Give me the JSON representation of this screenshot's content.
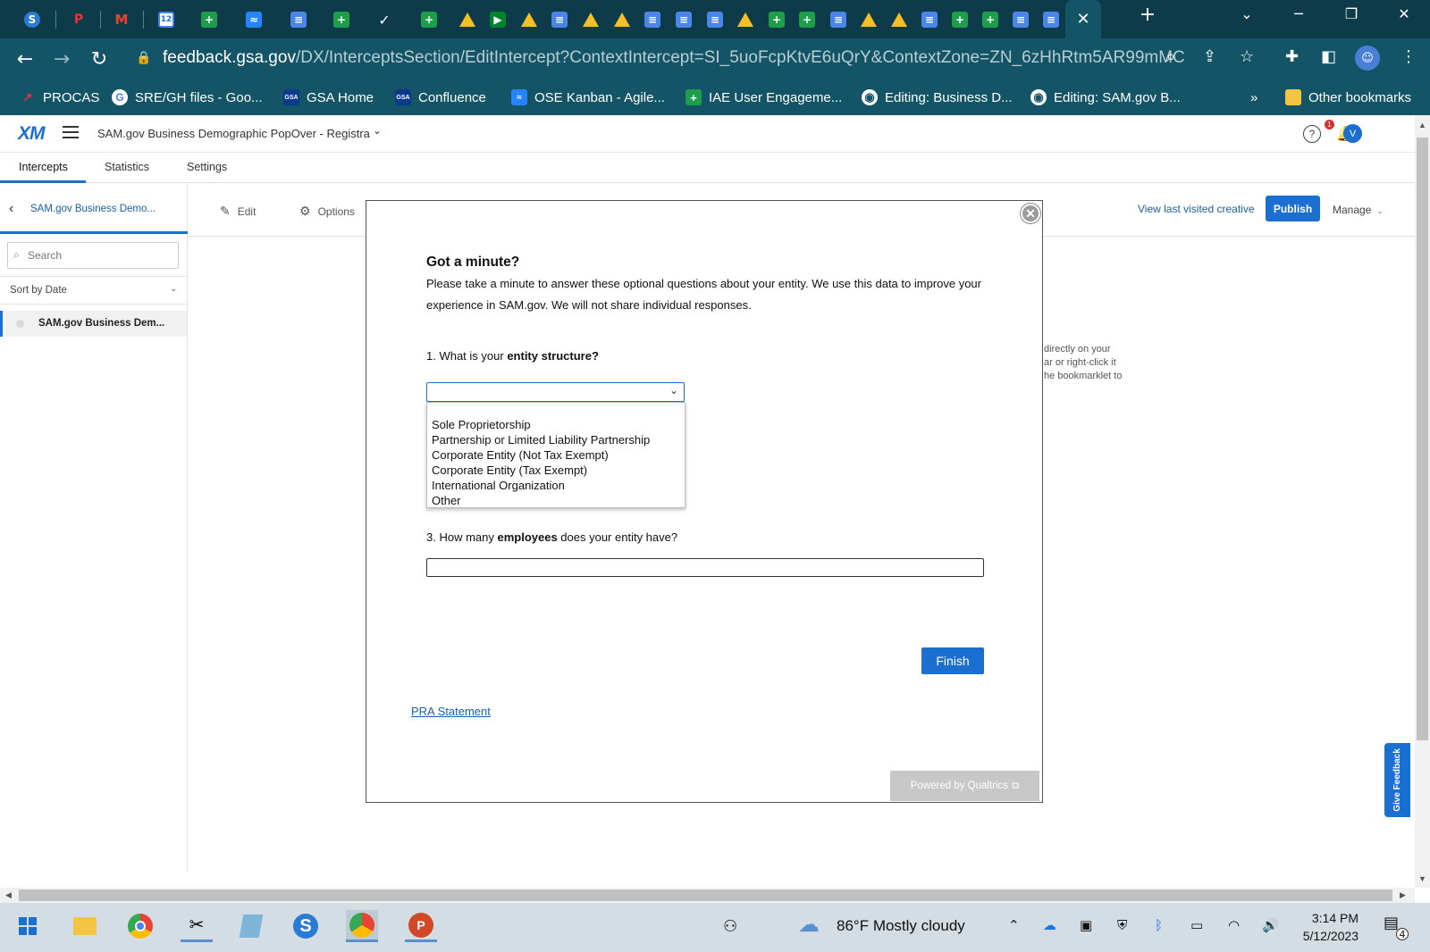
{
  "browser": {
    "tabs_close_glyph": "✕",
    "new_tab_glyph": "+",
    "url_host": "feedback.gsa.gov",
    "url_path": "/DX/InterceptsSection/EditIntercept?ContextIntercept=SI_5uoFcpKtvE6uQrY&ContextZone=ZN_6zHhRtm5AR99mMC",
    "bookmarks": [
      {
        "label": "PROCAS",
        "icon": "procas-icon"
      },
      {
        "label": "SRE/GH files - Goo...",
        "icon": "google-icon"
      },
      {
        "label": "GSA Home",
        "icon": "gsa-icon"
      },
      {
        "label": "Confluence",
        "icon": "gsa-icon"
      },
      {
        "label": "OSE Kanban - Agile...",
        "icon": "jira-icon"
      },
      {
        "label": "IAE User Engageme...",
        "icon": "sheets-icon"
      },
      {
        "label": "Editing: Business D...",
        "icon": "globe-icon"
      },
      {
        "label": "Editing: SAM.gov B...",
        "icon": "globe-icon"
      }
    ],
    "bookmarks_overflow": "»",
    "other_bookmarks": "Other bookmarks"
  },
  "app": {
    "logo": "XM",
    "project_title": "SAM.gov Business Demographic PopOver - Registration",
    "avatar_initial": "V",
    "notif_count": "1",
    "subtabs": [
      "Intercepts",
      "Statistics",
      "Settings"
    ]
  },
  "sidebar": {
    "back_label": "SAM.gov Business Demo...",
    "search_placeholder": "Search",
    "sort_label": "Sort by Date",
    "item_label": "SAM.gov Business Dem..."
  },
  "toolbar": {
    "edit": "Edit",
    "options": "Options",
    "view_last": "View last visited creative",
    "publish": "Publish",
    "manage": "Manage"
  },
  "background_hint": [
    "directly on your",
    "ar or right-click it",
    "he bookmarklet to"
  ],
  "modal": {
    "title": "Got a minute?",
    "intro": "Please take a minute to answer these optional questions about your entity. We use this data to improve your experience in SAM.gov. We will not share individual responses.",
    "q1_prefix": "1. What is your ",
    "q1_bold": "entity structure?",
    "dropdown_options": [
      "Sole Proprietorship",
      "Partnership or Limited Liability Partnership",
      "Corporate Entity (Not Tax Exempt)",
      "Corporate Entity (Tax Exempt)",
      "International Organization",
      "Other"
    ],
    "q3_prefix": "3. How many ",
    "q3_bold": "employees",
    "q3_suffix": " does your entity have?",
    "finish": "Finish",
    "pra": "PRA Statement",
    "powered": "Powered by Qualtrics"
  },
  "feedback_tab": "Give Feedback",
  "taskbar": {
    "weather": "86°F  Mostly cloudy",
    "time": "3:14 PM",
    "date": "5/12/2023",
    "notif_count": "4"
  }
}
